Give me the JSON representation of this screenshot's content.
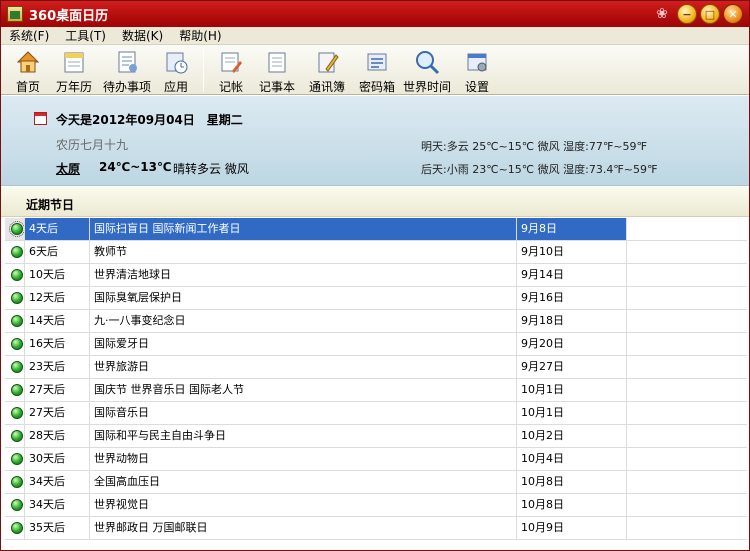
{
  "window": {
    "title": "360桌面日历"
  },
  "menu": [
    {
      "label": "系统(F)"
    },
    {
      "label": "工具(T)"
    },
    {
      "label": "数据(K)"
    },
    {
      "label": "帮助(H)"
    }
  ],
  "toolbar": {
    "group1": [
      {
        "label": "首页",
        "icon": "home-icon"
      },
      {
        "label": "万年历",
        "icon": "calendar-icon"
      },
      {
        "label": "待办事项",
        "icon": "todo-icon"
      },
      {
        "label": "应用",
        "icon": "clock-app-icon"
      }
    ],
    "group2": [
      {
        "label": "记帐",
        "icon": "ledger-icon"
      },
      {
        "label": "记事本",
        "icon": "notepad-icon"
      },
      {
        "label": "通讯簿",
        "icon": "address-book-icon"
      },
      {
        "label": "密码箱",
        "icon": "password-box-icon"
      },
      {
        "label": "世界时间",
        "icon": "world-time-icon"
      },
      {
        "label": "设置",
        "icon": "settings-icon"
      }
    ]
  },
  "info": {
    "today": "今天是2012年09月04日　星期二",
    "lunar": "农历七月十九",
    "city": "太原",
    "temp": "24℃~13℃",
    "condition": "晴转多云  微风",
    "tomorrow": "明天:多云 25℃~15℃ 微风 湿度:77℉~59℉",
    "day_after": "后天:小雨 23℃~15℃ 微风 湿度:73.4℉~59℉"
  },
  "section": {
    "title": "近期节日"
  },
  "holidays": [
    {
      "days": "4天后",
      "name": "国际扫盲日 国际新闻工作者日",
      "date": "9月8日",
      "selected": true
    },
    {
      "days": "6天后",
      "name": "教师节",
      "date": "9月10日"
    },
    {
      "days": "10天后",
      "name": "世界清洁地球日",
      "date": "9月14日"
    },
    {
      "days": "12天后",
      "name": "国际臭氧层保护日",
      "date": "9月16日"
    },
    {
      "days": "14天后",
      "name": "九·一八事变纪念日",
      "date": "9月18日"
    },
    {
      "days": "16天后",
      "name": "国际爱牙日",
      "date": "9月20日"
    },
    {
      "days": "23天后",
      "name": "世界旅游日",
      "date": "9月27日"
    },
    {
      "days": "27天后",
      "name": "国庆节 世界音乐日 国际老人节",
      "date": "10月1日"
    },
    {
      "days": "27天后",
      "name": "国际音乐日",
      "date": "10月1日"
    },
    {
      "days": "28天后",
      "name": "国际和平与民主自由斗争日",
      "date": "10月2日"
    },
    {
      "days": "30天后",
      "name": "世界动物日",
      "date": "10月4日"
    },
    {
      "days": "34天后",
      "name": "全国高血压日",
      "date": "10月8日"
    },
    {
      "days": "34天后",
      "name": "世界视觉日",
      "date": "10月8日"
    },
    {
      "days": "35天后",
      "name": "世界邮政日 万国邮联日",
      "date": "10月9日"
    }
  ]
}
